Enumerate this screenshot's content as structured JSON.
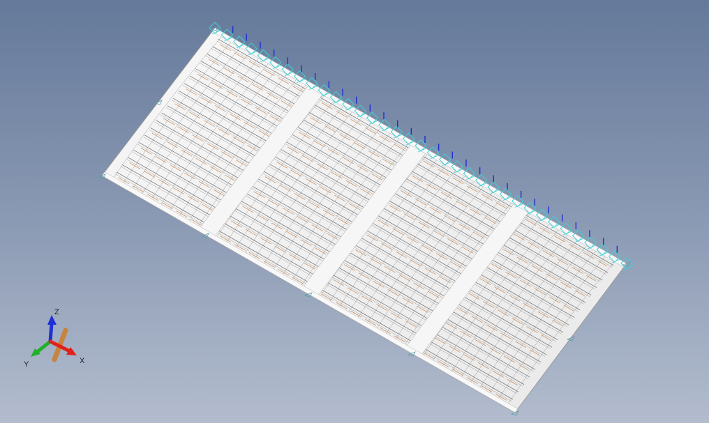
{
  "viewport": {
    "background_top": "#65799a",
    "background_bottom": "#b2bccd"
  },
  "model": {
    "panel_fill": "#f2f2f2",
    "panel_edge": "#9a9a9a",
    "mesh_line_color": "#555555",
    "rib_line_color": "#c47a3c",
    "constraint_color": "#3fd0d6",
    "load_arrow_color": "#1a2fd6",
    "crossbeam_count": 3,
    "slat_count": 20
  },
  "triad": {
    "x_label": "X",
    "y_label": "Y",
    "z_label": "Z",
    "x_color": "#e0201c",
    "y_color": "#22b02a",
    "z_color": "#1f2fd8",
    "view_axis_color": "#c7843f"
  }
}
